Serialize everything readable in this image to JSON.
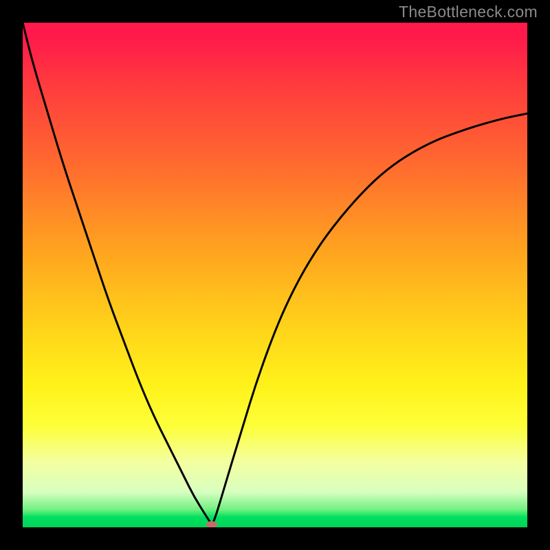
{
  "watermark": "TheBottleneck.com",
  "colors": {
    "frame_bg": "#000000",
    "curve": "#000000",
    "dot": "#c96a6a",
    "gradient_top": "#ff1a4b",
    "gradient_bottom": "#00d458"
  },
  "chart_data": {
    "type": "line",
    "title": "",
    "xlabel": "",
    "ylabel": "",
    "xlim": [
      0,
      100
    ],
    "ylim": [
      0,
      100
    ],
    "x": [
      0,
      2,
      5,
      8,
      11,
      14,
      17,
      20,
      23,
      26,
      29,
      32,
      34,
      36.5,
      37.5,
      38.2,
      40,
      43,
      47,
      52,
      58,
      65,
      72,
      80,
      88,
      95,
      100
    ],
    "values": [
      100,
      92,
      82,
      72,
      63,
      54,
      45,
      37,
      29,
      22,
      16,
      10,
      6,
      2,
      0.5,
      2,
      8,
      18,
      31,
      44,
      55,
      64,
      71,
      76,
      79,
      81,
      82
    ],
    "min_point_x": 37.5,
    "min_point_y": 0.5,
    "dot": {
      "x": 37.5,
      "y": 0.5
    }
  }
}
